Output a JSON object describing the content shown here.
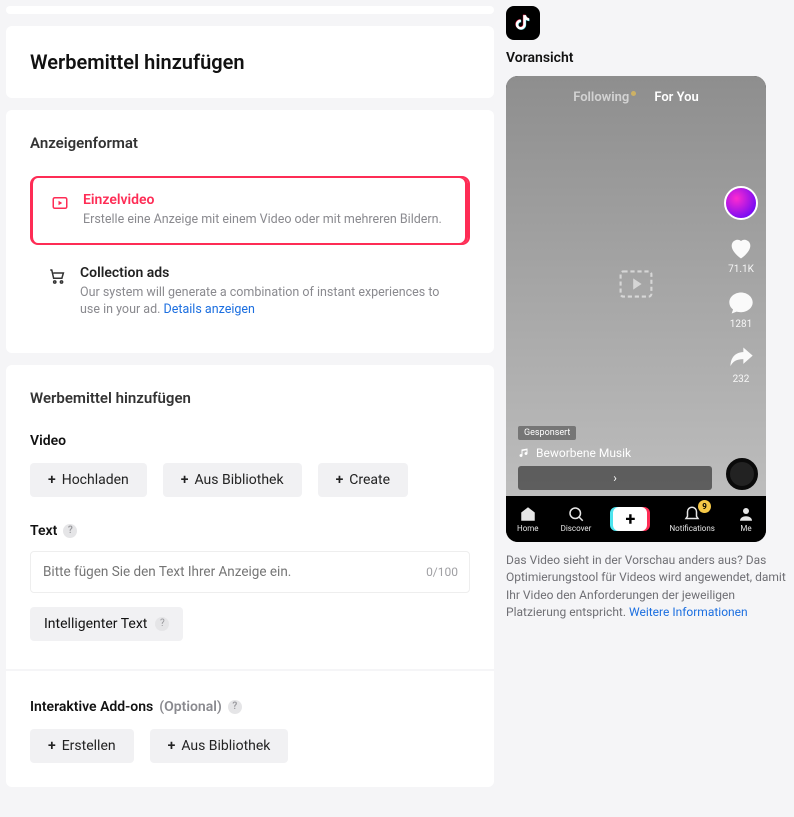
{
  "header": {
    "title": "Werbemittel hinzufügen"
  },
  "format": {
    "section_title": "Anzeigenformat",
    "single": {
      "title": "Einzelvideo",
      "desc": "Erstelle eine Anzeige mit einem Video oder mit mehreren Bildern."
    },
    "collection": {
      "title": "Collection ads",
      "desc_prefix": "Our system will generate a combination of instant experiences to use in your ad. ",
      "details_link": "Details anzeigen"
    }
  },
  "creative": {
    "section_title": "Werbemittel hinzufügen",
    "video_label": "Video",
    "btn_upload": "Hochladen",
    "btn_library": "Aus Bibliothek",
    "btn_create": "Create",
    "text_label": "Text",
    "text_placeholder": "Bitte fügen Sie den Text Ihrer Anzeige ein.",
    "text_counter": "0/100",
    "smart_text": "Intelligenter Text"
  },
  "addons": {
    "label": "Interaktive Add-ons",
    "optional": "(Optional)",
    "btn_create": "Erstellen",
    "btn_library": "Aus Bibliothek"
  },
  "preview": {
    "title": "Voransicht",
    "following": "Following",
    "for_you": "For You",
    "likes": "71.1K",
    "comments": "1281",
    "shares": "232",
    "sponsored": "Gesponsert",
    "music": "Beworbene Musik",
    "cta_arrow": "›",
    "bottom": {
      "home": "Home",
      "discover": "Discover",
      "notifications": "Notifications",
      "me": "Me",
      "badge": "9"
    },
    "note_prefix": "Das Video sieht in der Vorschau anders aus? Das Optimierungstool für Videos wird angewendet, damit Ihr Video den Anforderungen der jeweiligen Platzierung entspricht. ",
    "note_link": "Weitere Informationen"
  }
}
